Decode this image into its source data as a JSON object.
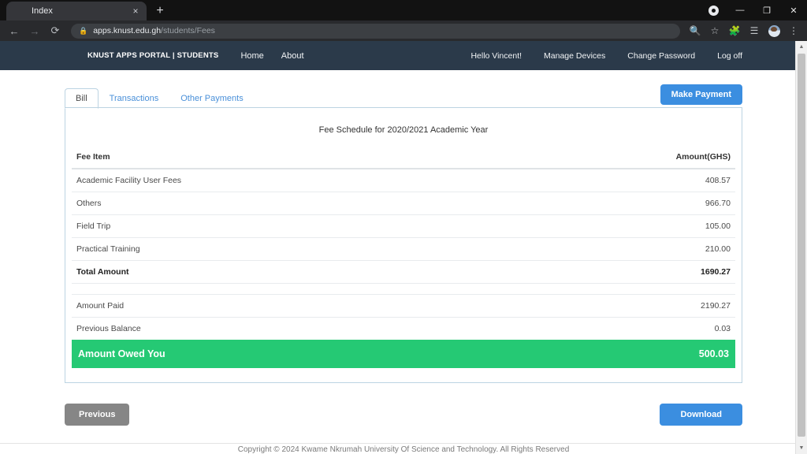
{
  "browser": {
    "tab": {
      "title": "Index",
      "favicon": "knust-crest-icon",
      "close": "×"
    },
    "new_tab": "+",
    "window_controls": {
      "record": "record-icon",
      "minimize": "—",
      "maximize": "❐",
      "close": "✕"
    },
    "nav": {
      "back": "←",
      "forward": "→",
      "reload": "⟳"
    },
    "omnibox": {
      "lock": "🔒",
      "url_domain": "apps.knust.edu.gh",
      "url_path": "/students/Fees"
    },
    "toolbar_icons": [
      "search-icon",
      "bookmark-star-icon",
      "extensions-puzzle-icon",
      "reading-list-icon",
      "profile-avatar",
      "chrome-menu-icon"
    ]
  },
  "navbar": {
    "logo": "knust-crest-logo",
    "brand": "KNUST APPS PORTAL | STUDENTS",
    "links": [
      "Home",
      "About"
    ],
    "right_links": [
      "Hello Vincent!",
      "Manage Devices",
      "Change Password",
      "Log off"
    ]
  },
  "tabs": [
    {
      "label": "Bill",
      "active": true
    },
    {
      "label": "Transactions",
      "active": false
    },
    {
      "label": "Other Payments",
      "active": false
    }
  ],
  "actions": {
    "make_payment": "Make Payment",
    "previous": "Previous",
    "download": "Download"
  },
  "bill": {
    "title": "Fee Schedule for 2020/2021 Academic Year",
    "headers": [
      "Fee Item",
      "Amount(GHS)"
    ],
    "rows": [
      {
        "item": "Academic Facility User Fees",
        "amount": "408.57"
      },
      {
        "item": "Others",
        "amount": "966.70"
      },
      {
        "item": "Field Trip",
        "amount": "105.00"
      },
      {
        "item": "Practical Training",
        "amount": "210.00"
      },
      {
        "item": "Total Amount",
        "amount": "1690.27"
      },
      {
        "item": "Amount Paid",
        "amount": "2190.27"
      },
      {
        "item": "Previous Balance",
        "amount": "0.03"
      },
      {
        "item": "Amount Owed You",
        "amount": "500.03"
      }
    ]
  },
  "footer": {
    "text": "Copyright © 2024 Kwame Nkrumah University Of Science and Technology. All Rights Reserved"
  },
  "colors": {
    "navbar": "#2b3a4a",
    "primary_button": "#3b8ee0",
    "owed_green": "#25c974",
    "secondary_button": "#868686",
    "card_border": "#bcd4e2"
  },
  "scrollbar": {
    "up": "▲",
    "down": "▼"
  }
}
